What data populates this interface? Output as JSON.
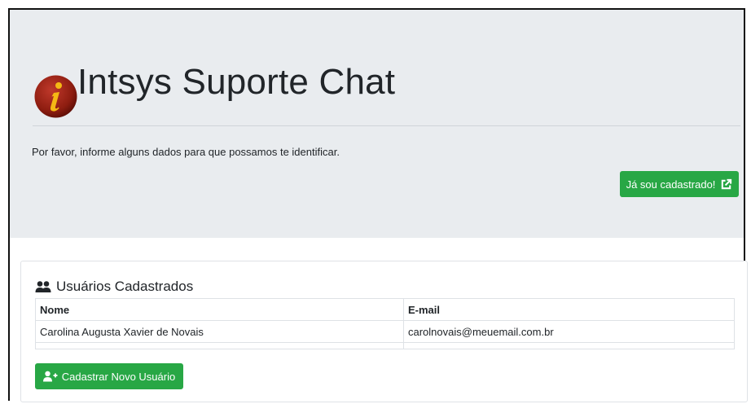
{
  "header": {
    "app_title": "Intsys Suporte Chat",
    "lead_text": "Por favor, informe alguns dados para que possamos te identificar.",
    "registered_button_label": "Já sou cadastrado!",
    "registered_button_icon": "external-link-icon",
    "logo_icon": "intsys-logo-icon",
    "accent_color": "#28a745"
  },
  "users_card": {
    "title": "Usuários Cadastrados",
    "title_icon": "users-icon",
    "columns": [
      "Nome",
      "E-mail"
    ],
    "rows": [
      {
        "name": "Carolina Augusta Xavier de Novais",
        "email": "carolnovais@meuemail.com.br"
      }
    ],
    "new_user_button_label": "Cadastrar Novo Usuário",
    "new_user_button_icon": "user-plus-icon"
  }
}
